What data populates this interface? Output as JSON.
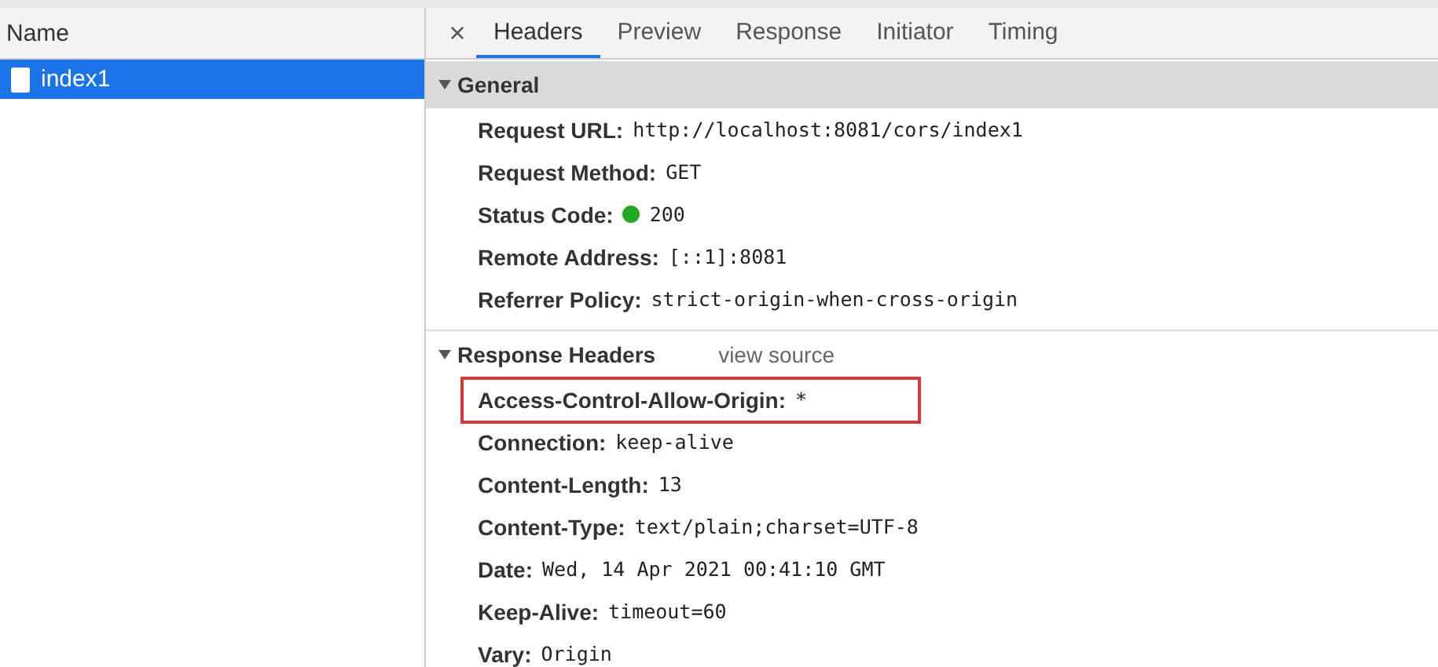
{
  "requests": {
    "column": "Name",
    "items": [
      {
        "name": "index1",
        "selected": true
      }
    ]
  },
  "tabs": [
    {
      "label": "Headers",
      "selected": true
    },
    {
      "label": "Preview",
      "selected": false
    },
    {
      "label": "Response",
      "selected": false
    },
    {
      "label": "Initiator",
      "selected": false
    },
    {
      "label": "Timing",
      "selected": false
    }
  ],
  "close_icon": "×",
  "sections": [
    {
      "title": "General",
      "expanded": true,
      "rows": [
        {
          "name": "Request URL:",
          "value": "http://localhost:8081/cors/index1",
          "highlighted": false
        },
        {
          "name": "Request Method:",
          "value": "GET",
          "highlighted": false
        },
        {
          "name": "Status Code:",
          "value": "200",
          "color": "#22aa22",
          "highlighted": false
        },
        {
          "name": "Remote Address:",
          "value": "[::1]:8081",
          "highlighted": false
        },
        {
          "name": "Referrer Policy:",
          "value": "strict-origin-when-cross-origin",
          "highlighted": false
        }
      ]
    },
    {
      "title": "Response Headers",
      "link": "view source",
      "expanded": true,
      "rows": [
        {
          "name": "Access-Control-Allow-Origin:",
          "value": "*",
          "highlighted": true
        },
        {
          "name": "Connection:",
          "value": "keep-alive",
          "highlighted": false
        },
        {
          "name": "Content-Length:",
          "value": "13",
          "highlighted": false
        },
        {
          "name": "Content-Type:",
          "value": "text/plain;charset=UTF-8",
          "highlighted": false
        },
        {
          "name": "Date:",
          "value": "Wed, 14 Apr 2021 00:41:10 GMT",
          "highlighted": false
        },
        {
          "name": "Keep-Alive:",
          "value": "timeout=60",
          "highlighted": false
        },
        {
          "name": "Vary:",
          "value": "Origin",
          "highlighted": false
        }
      ]
    }
  ]
}
